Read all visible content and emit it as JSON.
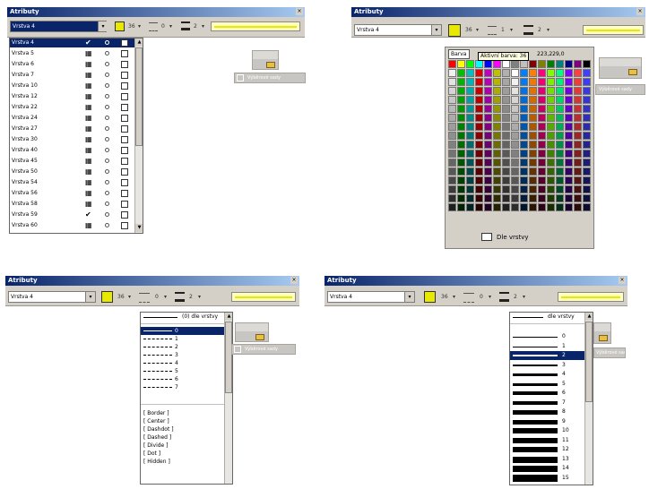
{
  "window_title": "Atributy",
  "close_glyph": "×",
  "layer_value": "Vrstva 4",
  "dropdown_glyph": "▾",
  "color_label": "36",
  "linetype_label": "0",
  "lineweight_label": "2",
  "panel2_linetype_label": "1",
  "ghost_toolbar": {
    "label": "Výběrové sady",
    "icon": "layer-stack-icon"
  },
  "layers": {
    "selected": "Vrstva 4",
    "items": [
      {
        "name": "Vrstva 4",
        "on": true
      },
      {
        "name": "Vrstva 5",
        "on": false
      },
      {
        "name": "Vrstva 6",
        "on": false
      },
      {
        "name": "Vrstva 7",
        "on": false
      },
      {
        "name": "Vrstva 10",
        "on": false
      },
      {
        "name": "Vrstva 12",
        "on": false
      },
      {
        "name": "Vrstva 22",
        "on": false
      },
      {
        "name": "Vrstva 24",
        "on": false
      },
      {
        "name": "Vrstva 27",
        "on": false
      },
      {
        "name": "Vrstva 30",
        "on": false
      },
      {
        "name": "Vrstva 40",
        "on": false
      },
      {
        "name": "Vrstva 45",
        "on": false
      },
      {
        "name": "Vrstva 50",
        "on": false
      },
      {
        "name": "Vrstva 54",
        "on": false
      },
      {
        "name": "Vrstva 56",
        "on": false
      },
      {
        "name": "Vrstva 58",
        "on": false
      },
      {
        "name": "Vrstva 59",
        "on": true
      },
      {
        "name": "Vrstva 60",
        "on": false
      }
    ]
  },
  "color_picker": {
    "tab_label": "Barva",
    "tooltip": "Aktivní barva: 36",
    "rgb_readout": "223,229,0",
    "footer_button": "Dle vrstvy",
    "columns": 16,
    "rows": 17,
    "top_colors": [
      "#ff0000",
      "#ffff00",
      "#00ff00",
      "#00ffff",
      "#0000ff",
      "#ff00ff",
      "#ffffff",
      "#808080",
      "#c0c0c0",
      "#800000",
      "#808000",
      "#008000",
      "#008080",
      "#000080",
      "#800080",
      "#000000"
    ],
    "hues": [
      "#0000ff",
      "#00c000",
      "#00c0c0",
      "#e00000",
      "#c000c0",
      "#c0c000",
      "#b0b0b0",
      "#ffffff",
      "#0080ff",
      "#ff8000",
      "#ff0080",
      "#80ff00",
      "#00ff80",
      "#8000ff",
      "#ff4040",
      "#4040ff"
    ]
  },
  "linetype_list": {
    "header_item": "(0) dle vrstvy",
    "selected": "0",
    "numbered": [
      "0",
      "1",
      "2",
      "3",
      "4",
      "5",
      "6",
      "7"
    ],
    "named": [
      "[ Border ]",
      "[ Center ]",
      "[ Dashdot ]",
      "[ Dashed ]",
      "[ Divide ]",
      "[ Dot ]",
      "[ Hidden ]"
    ]
  },
  "lineweight_list": {
    "header_item": "dle vrstvy",
    "selected": "2",
    "items": [
      "0",
      "1",
      "2",
      "3",
      "4",
      "5",
      "6",
      "7",
      "8",
      "9",
      "10",
      "11",
      "12",
      "13",
      "14",
      "15"
    ]
  },
  "colors": {
    "title_start": "#0a246a",
    "title_end": "#a6caf0",
    "face": "#d4d0c8",
    "selection": "#0a246a",
    "swatch_yellow": "#e8e800"
  }
}
